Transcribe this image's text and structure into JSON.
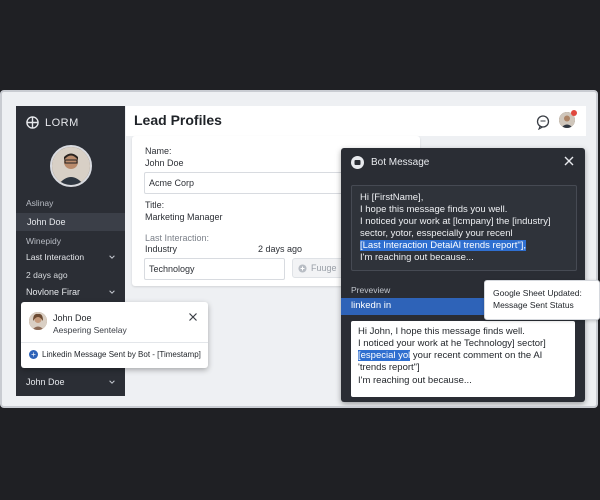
{
  "sidebar": {
    "brand": "LORM",
    "section_label": "Aslinay",
    "selected_name": "John Doe",
    "group_label": "Winepidy",
    "last_interaction_label": "Last Interaction",
    "last_interaction_value": "2 days ago",
    "next_name": "Novlone Firar",
    "bottom_name": "John Doe"
  },
  "header": {
    "title": "Lead Profiles"
  },
  "profile": {
    "name_label": "Name:",
    "name_value": "John Doe",
    "company_value": "Acme Corp",
    "title_label": "Title:",
    "title_value": "Marketing Manager",
    "last_interaction_label": "Last Interaction:",
    "industry_label": "Industry",
    "industry_when": "2 days ago",
    "industry_value": "Technology",
    "chip_label": "Fuuge"
  },
  "bot": {
    "title": "Bot Message",
    "message_lines": [
      "Hi [FirstName],",
      "I hope this message finds you well.",
      "I noticed your work at [lcmpany] the [industry]",
      "sector, yotor, esspecially your recenl",
      "[Last Interaction DetaiAl trends report\"],",
      "I'm reaching out because..."
    ],
    "preview_label": "Preveview",
    "channel": "linkedn in",
    "preview_lines": [
      "Hi John, I hope this message finds well.",
      "I noticed your work at he Technology] sector]",
      "[especial yol",
      " your recent comment on the AI",
      "'trends report\"]",
      "I'm reaching out because..."
    ]
  },
  "tooltip": {
    "line1": "Google Sheet Updated:",
    "line2": "Message Sent Status"
  },
  "notification": {
    "name": "John Doe",
    "subtitle": "Aespering Sentelay",
    "status": "Linkedin Message Sent by Bot - [Timestamp]"
  },
  "colors": {
    "accent": "#2e63b8",
    "highlight": "#2f6fd0",
    "sidebar": "#2b2e35",
    "background": "#1f2024"
  },
  "icons": {
    "logo": "grid-icon",
    "chat": "chat-icon",
    "close": "close-icon",
    "chevron": "chevron-down-icon",
    "plus": "plus-circle-icon"
  }
}
